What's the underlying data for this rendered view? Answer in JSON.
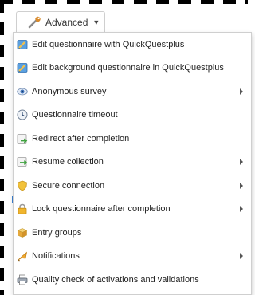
{
  "advanced_button": {
    "label": "Advanced",
    "icon": "wrench-icon"
  },
  "menu": {
    "items": [
      {
        "label": "Edit questionnaire with QuickQuestplus",
        "icon": "edit-questionnaire-icon",
        "has_submenu": false
      },
      {
        "label": "Edit background questionnaire in QuickQuestplus",
        "icon": "edit-questionnaire-icon",
        "has_submenu": false
      },
      {
        "label": "Anonymous survey",
        "icon": "eye-icon",
        "has_submenu": true
      },
      {
        "label": "Questionnaire timeout",
        "icon": "clock-icon",
        "has_submenu": false
      },
      {
        "label": "Redirect after completion",
        "icon": "redirect-icon",
        "has_submenu": false
      },
      {
        "label": "Resume collection",
        "icon": "resume-icon",
        "has_submenu": true
      },
      {
        "label": "Secure connection",
        "icon": "shield-icon",
        "has_submenu": true
      },
      {
        "label": "Lock questionnaire after completion",
        "icon": "lock-icon",
        "has_submenu": true
      },
      {
        "label": "Entry groups",
        "icon": "boxes-icon",
        "has_submenu": false
      },
      {
        "label": "Notifications",
        "icon": "megaphone-icon",
        "has_submenu": true
      },
      {
        "label": "Quality check of activations and validations",
        "icon": "printer-icon",
        "has_submenu": false
      }
    ]
  },
  "colors": {
    "menu_background": "#ffffff",
    "menu_border": "#cfcfcf",
    "text": "#222222",
    "submenu_arrow": "#555555",
    "dashed_outline": "#000000"
  }
}
